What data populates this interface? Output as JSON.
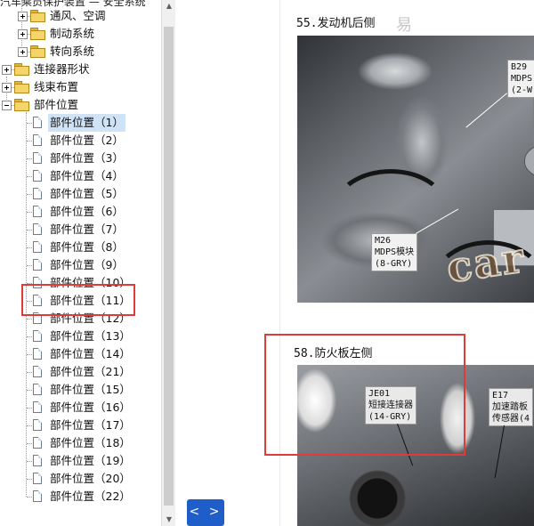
{
  "tree": {
    "header_clipped": "汽车乘员保护装置 — 安全系统",
    "items": [
      {
        "label": "通风、空调",
        "level": 1,
        "kind": "folder",
        "expander": "plus"
      },
      {
        "label": "制动系统",
        "level": 1,
        "kind": "folder",
        "expander": "plus"
      },
      {
        "label": "转向系统",
        "level": 1,
        "kind": "folder",
        "expander": "plus"
      },
      {
        "label": "连接器形状",
        "level": 0,
        "kind": "folder",
        "expander": "plus"
      },
      {
        "label": "线束布置",
        "level": 0,
        "kind": "folder",
        "expander": "plus"
      },
      {
        "label": "部件位置",
        "level": 0,
        "kind": "folder",
        "expander": "minus"
      },
      {
        "label": "部件位置（1）",
        "level": 1,
        "kind": "page",
        "selected": true
      },
      {
        "label": "部件位置（2）",
        "level": 1,
        "kind": "page"
      },
      {
        "label": "部件位置（3）",
        "level": 1,
        "kind": "page"
      },
      {
        "label": "部件位置（4）",
        "level": 1,
        "kind": "page"
      },
      {
        "label": "部件位置（5）",
        "level": 1,
        "kind": "page"
      },
      {
        "label": "部件位置（6）",
        "level": 1,
        "kind": "page"
      },
      {
        "label": "部件位置（7）",
        "level": 1,
        "kind": "page"
      },
      {
        "label": "部件位置（8）",
        "level": 1,
        "kind": "page"
      },
      {
        "label": "部件位置（9）",
        "level": 1,
        "kind": "page"
      },
      {
        "label": "部件位置（10）",
        "level": 1,
        "kind": "page"
      },
      {
        "label": "部件位置（11）",
        "level": 1,
        "kind": "page",
        "highlighted": true
      },
      {
        "label": "部件位置（12）",
        "level": 1,
        "kind": "page"
      },
      {
        "label": "部件位置（13）",
        "level": 1,
        "kind": "page"
      },
      {
        "label": "部件位置（14）",
        "level": 1,
        "kind": "page"
      },
      {
        "label": "部件位置（21）",
        "level": 1,
        "kind": "page"
      },
      {
        "label": "部件位置（15）",
        "level": 1,
        "kind": "page"
      },
      {
        "label": "部件位置（16）",
        "level": 1,
        "kind": "page"
      },
      {
        "label": "部件位置（17）",
        "level": 1,
        "kind": "page"
      },
      {
        "label": "部件位置（18）",
        "level": 1,
        "kind": "page"
      },
      {
        "label": "部件位置（19）",
        "level": 1,
        "kind": "page"
      },
      {
        "label": "部件位置（20）",
        "level": 1,
        "kind": "page"
      },
      {
        "label": "部件位置（22）",
        "level": 1,
        "kind": "page"
      }
    ]
  },
  "viewer": {
    "section1": {
      "title": "55.发动机后侧",
      "callout_b29": [
        "B29",
        "MDPS",
        "(2-W"
      ],
      "callout_m26": [
        "M26",
        "MDPS模块",
        "(8-GRY)"
      ]
    },
    "section2": {
      "title": "58.防火板左侧",
      "callout_je01": [
        "JE01",
        "短接连接器",
        "(14-GRY)"
      ],
      "callout_e17": [
        "E17",
        "加速踏板",
        "传感器(4"
      ]
    },
    "watermark": "car",
    "watermark_top": "易"
  },
  "nav": {
    "button_label": "< >"
  },
  "colors": {
    "annotation": "#e03b3b",
    "nav_button": "#1f5dc9",
    "selection": "#cfe2f6"
  }
}
